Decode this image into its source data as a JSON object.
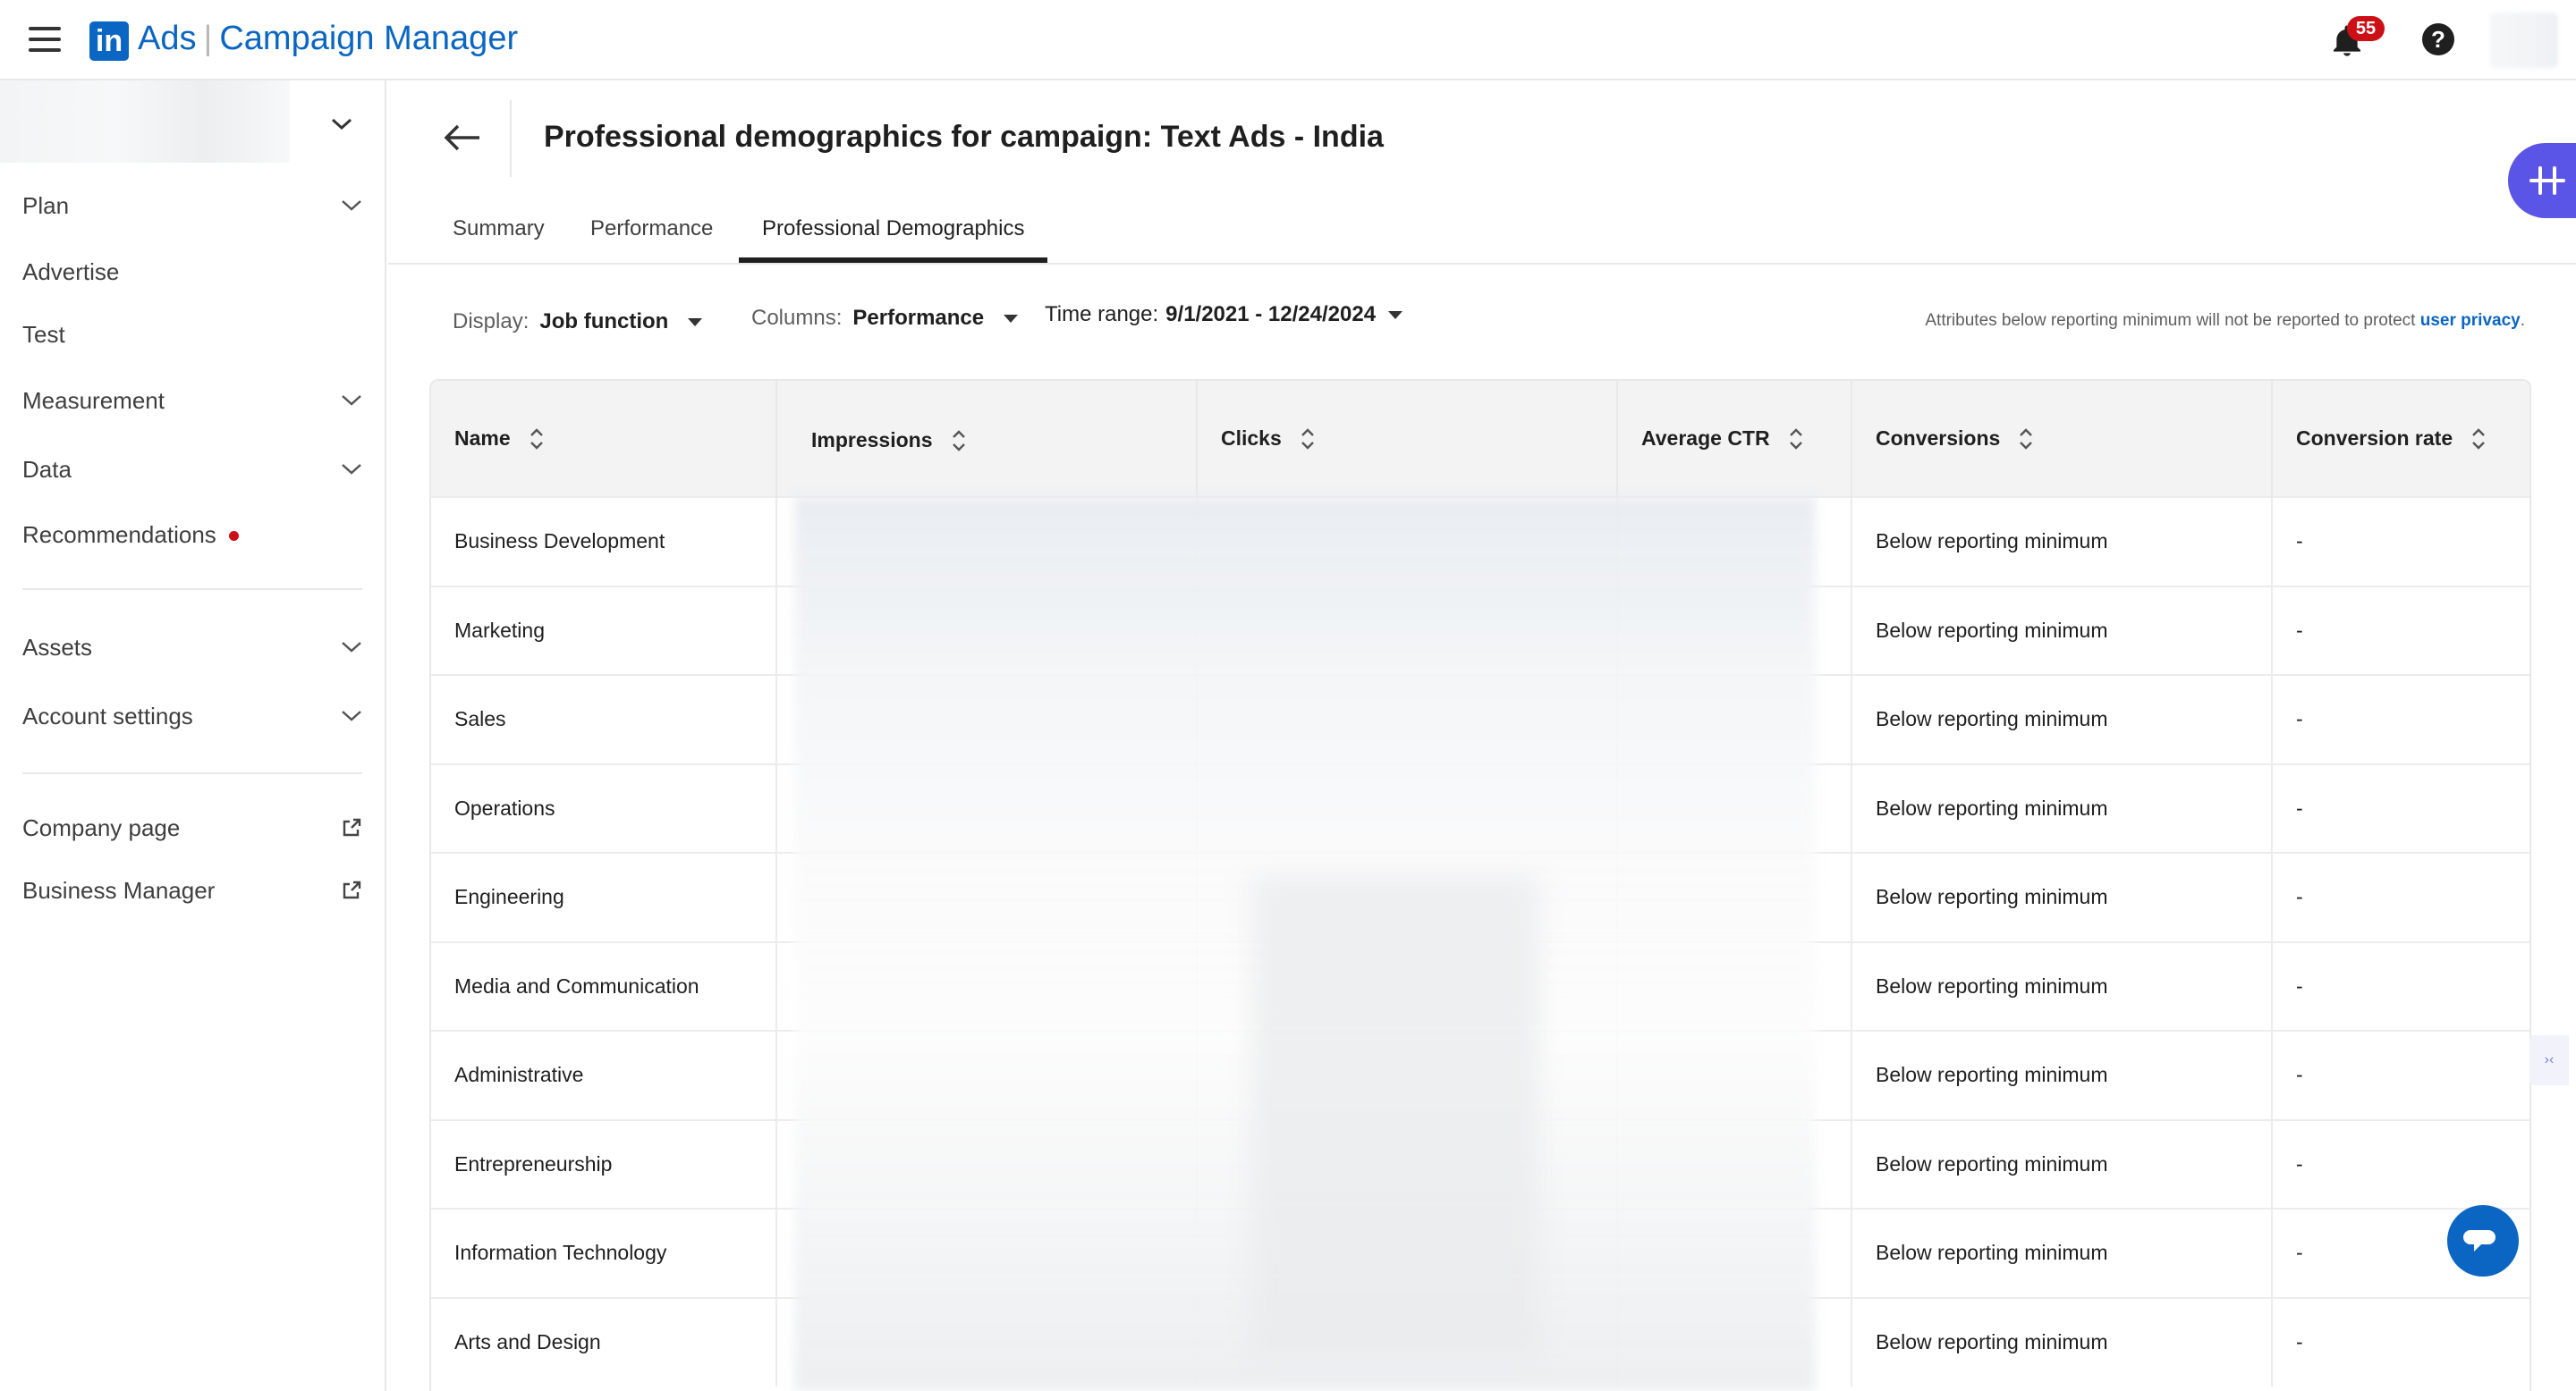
{
  "app": {
    "logo_text": "in",
    "brand_product": "Ads",
    "brand_separator": "|",
    "brand_name": "Campaign Manager",
    "notification_count": "55",
    "help_glyph": "?"
  },
  "sidebar": {
    "items": [
      {
        "label": "Plan",
        "expandable": true
      },
      {
        "label": "Advertise",
        "expandable": false
      },
      {
        "label": "Test",
        "expandable": false
      },
      {
        "label": "Measurement",
        "expandable": true
      },
      {
        "label": "Data",
        "expandable": true
      },
      {
        "label": "Recommendations",
        "expandable": false,
        "indicator": "red-dot"
      },
      {
        "label": "Assets",
        "expandable": true
      },
      {
        "label": "Account settings",
        "expandable": true
      },
      {
        "label": "Company page",
        "external": true
      },
      {
        "label": "Business Manager",
        "external": true
      }
    ]
  },
  "header": {
    "title": "Professional demographics for campaign: Text Ads - India"
  },
  "tabs": [
    {
      "label": "Summary",
      "active": false
    },
    {
      "label": "Performance",
      "active": false
    },
    {
      "label": "Professional Demographics",
      "active": true
    }
  ],
  "filters": {
    "display_label": "Display:",
    "display_value": "Job function",
    "columns_label": "Columns:",
    "columns_value": "Performance",
    "time_label": "Time range:",
    "time_value": "9/1/2021 - 12/24/2024"
  },
  "privacy_note": {
    "text": "Attributes below reporting minimum will not be reported to protect",
    "link": "user privacy",
    "suffix": "."
  },
  "table": {
    "columns": [
      "Name",
      "Impressions",
      "Clicks",
      "Average CTR",
      "Conversions",
      "Conversion rate"
    ],
    "rows": [
      {
        "name": "Business Development",
        "conversions": "Below reporting minimum",
        "conversion_rate": "-"
      },
      {
        "name": "Marketing",
        "conversions": "Below reporting minimum",
        "conversion_rate": "-"
      },
      {
        "name": "Sales",
        "conversions": "Below reporting minimum",
        "conversion_rate": "-"
      },
      {
        "name": "Operations",
        "conversions": "Below reporting minimum",
        "conversion_rate": "-"
      },
      {
        "name": "Engineering",
        "conversions": "Below reporting minimum",
        "conversion_rate": "-"
      },
      {
        "name": "Media and Communication",
        "conversions": "Below reporting minimum",
        "conversion_rate": "-"
      },
      {
        "name": "Administrative",
        "conversions": "Below reporting minimum",
        "conversion_rate": "-"
      },
      {
        "name": "Entrepreneurship",
        "conversions": "Below reporting minimum",
        "conversion_rate": "-"
      },
      {
        "name": "Information Technology",
        "conversions": "Below reporting minimum",
        "conversion_rate": "-"
      },
      {
        "name": "Arts and Design",
        "conversions": "Below reporting minimum",
        "conversion_rate": "-"
      }
    ]
  },
  "colors": {
    "brand_blue": "#0a66c2",
    "notification_red": "#cc1016",
    "assistant_purple": "#5a55e6"
  },
  "icons": [
    "menu-icon",
    "bell-icon",
    "help-icon",
    "chevron-down-icon",
    "external-link-icon",
    "back-arrow-icon",
    "sort-icon",
    "caret-down-icon",
    "assistant-icon",
    "chat-icon"
  ]
}
